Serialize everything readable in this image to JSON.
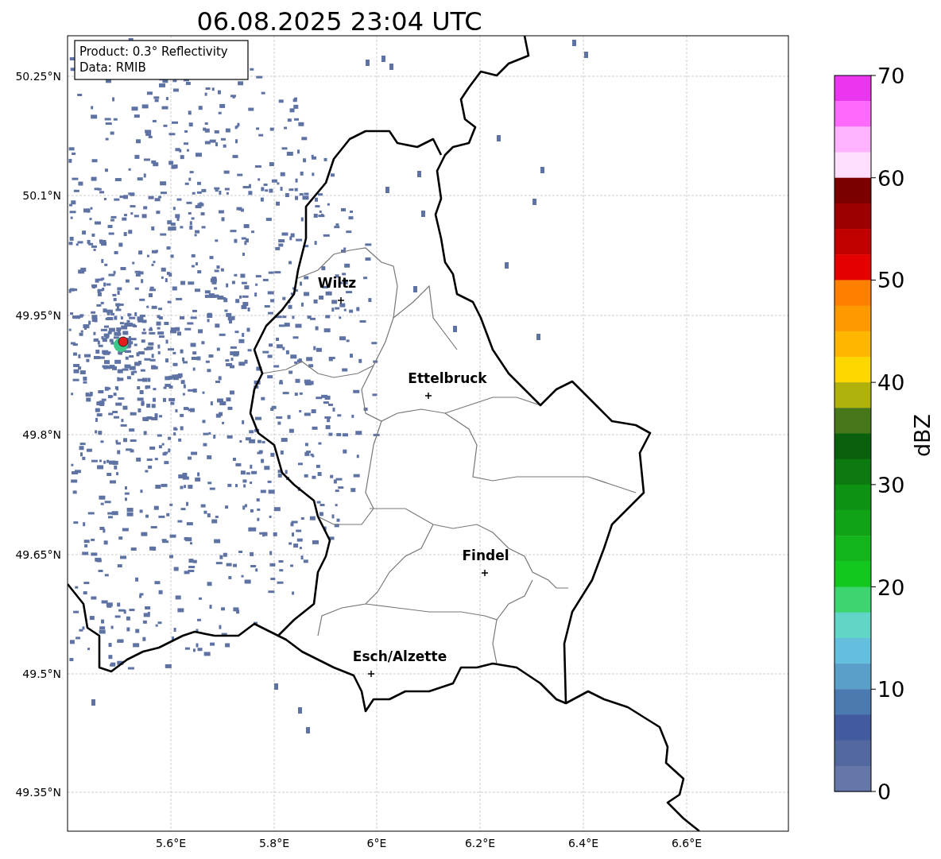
{
  "title": "06.08.2025 23:04 UTC",
  "info_box": [
    "Product: 0.3° Reflectivity",
    "Data: RMIB"
  ],
  "x_ticks": [
    "5.6°E",
    "5.8°E",
    "6°E",
    "6.2°E",
    "6.4°E",
    "6.6°E"
  ],
  "y_ticks": [
    "50.25°N",
    "50.1°N",
    "49.95°N",
    "49.8°N",
    "49.65°N",
    "49.5°N",
    "49.35°N"
  ],
  "cities": [
    {
      "name": "Wiltz"
    },
    {
      "name": "Ettelbruck"
    },
    {
      "name": "Findel"
    },
    {
      "name": "Esch/Alzette"
    }
  ],
  "colorbar": {
    "label": "dBZ",
    "ticks": [
      "70",
      "60",
      "50",
      "40",
      "30",
      "20",
      "10",
      "0"
    ],
    "bands": [
      {
        "color": "#ea37ef"
      },
      {
        "color": "#ff6afd"
      },
      {
        "color": "#ffb2fd"
      },
      {
        "color": "#ffddfd"
      },
      {
        "color": "#7a0000"
      },
      {
        "color": "#9c0000"
      },
      {
        "color": "#c10000"
      },
      {
        "color": "#e50000"
      },
      {
        "color": "#ff7f00"
      },
      {
        "color": "#ff9900"
      },
      {
        "color": "#ffb600"
      },
      {
        "color": "#fed700"
      },
      {
        "color": "#b0b10a"
      },
      {
        "color": "#46771a"
      },
      {
        "color": "#0a600c"
      },
      {
        "color": "#0c7a10"
      },
      {
        "color": "#0e9214"
      },
      {
        "color": "#10a316"
      },
      {
        "color": "#12b51a"
      },
      {
        "color": "#12c71e"
      },
      {
        "color": "#3dd570"
      },
      {
        "color": "#61d6c6"
      },
      {
        "color": "#63bfdd"
      },
      {
        "color": "#5a9fc9"
      },
      {
        "color": "#4b7ab0"
      },
      {
        "color": "#415b9e"
      },
      {
        "color": "#53689f"
      },
      {
        "color": "#6577a8"
      }
    ]
  }
}
